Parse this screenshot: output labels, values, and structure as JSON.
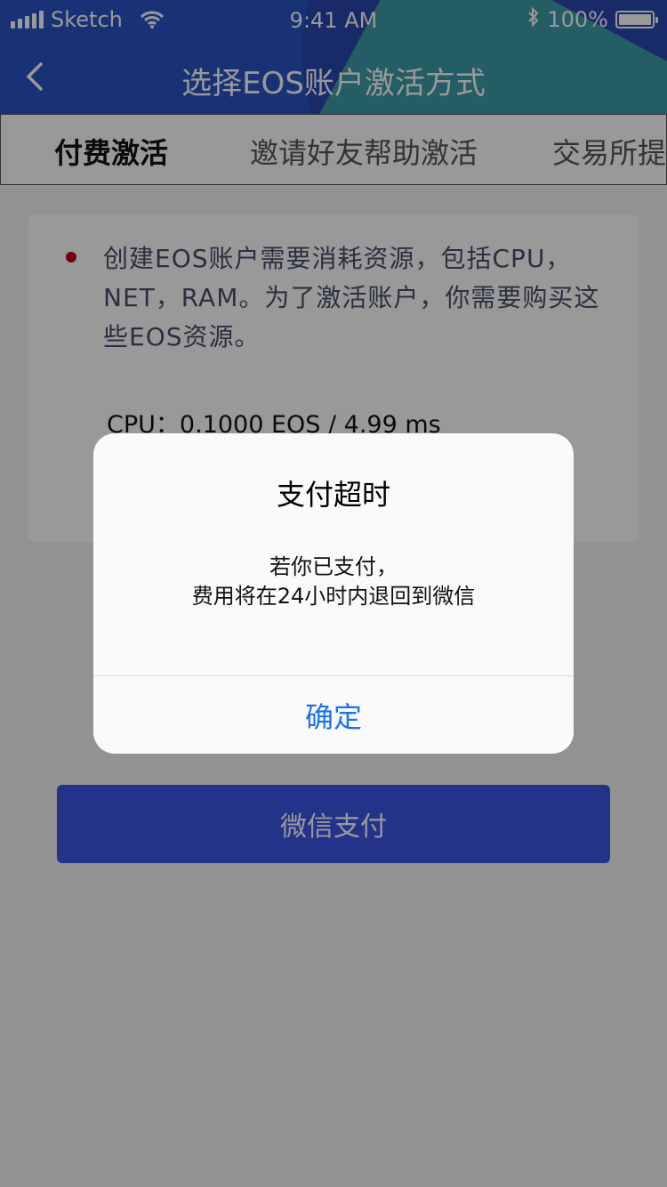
{
  "status_bar": {
    "carrier": "Sketch",
    "time": "9:41 AM",
    "battery": "100%"
  },
  "navbar": {
    "title": "选择EOS账户激活方式"
  },
  "tabs": [
    {
      "label": "付费激活",
      "active": true
    },
    {
      "label": "邀请好友帮助激活",
      "active": false
    },
    {
      "label": "交易所提",
      "active": false
    }
  ],
  "card": {
    "description": "创建EOS账户需要消耗资源，包括CPU，NET，RAM。为了激活账户，你需要购买这些EOS资源。",
    "cpu_line": "CPU：0.1000 EOS / 4.99 ms"
  },
  "pay_button": {
    "label": "微信支付"
  },
  "dialog": {
    "title": "支付超时",
    "message_line1": "若你已支付，",
    "message_line2": "费用将在24小时内退回到微信",
    "confirm_label": "确定"
  },
  "colors": {
    "header_blue": "#2b54c4",
    "header_teal": "#3fa3a5",
    "primary_button": "#3b55e6",
    "bullet_red": "#c00017",
    "dialog_link": "#1a73e8"
  }
}
